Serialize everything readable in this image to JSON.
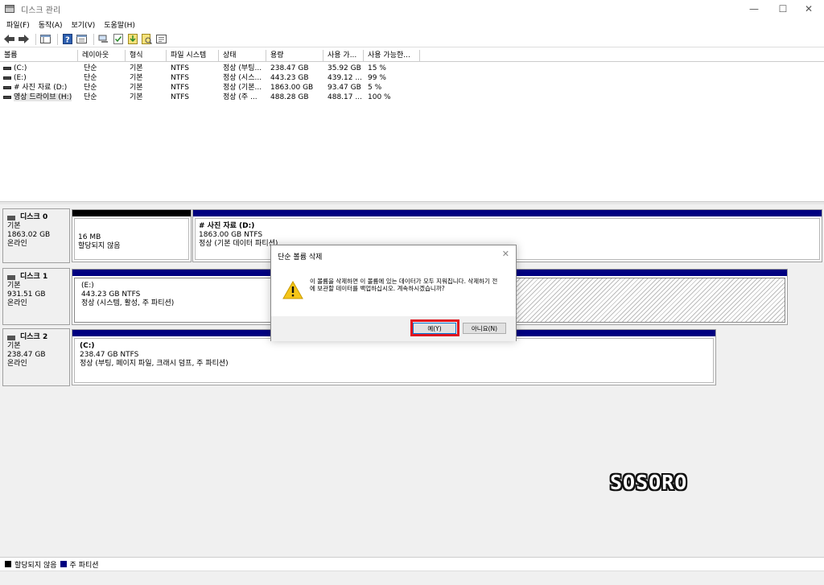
{
  "window": {
    "title": "디스크 관리",
    "minimize": "—",
    "maximize": "☐",
    "close": "✕"
  },
  "menu": [
    "파일(F)",
    "동작(A)",
    "보기(V)",
    "도움말(H)"
  ],
  "toolbar_icons": [
    "back-icon",
    "forward-icon",
    "console-tree-icon",
    "help-icon",
    "properties-icon",
    "connect-icon",
    "check-icon",
    "import-icon",
    "rescan-icon",
    "settings-icon"
  ],
  "volume_table": {
    "headers": [
      "볼륨",
      "레이아웃",
      "형식",
      "파일 시스템",
      "상태",
      "용량",
      "사용 가...",
      "사용 가능한..."
    ],
    "rows": [
      [
        "(C:)",
        "단순",
        "기본",
        "NTFS",
        "정상 (부팅...",
        "238.47 GB",
        "35.92 GB",
        "15 %"
      ],
      [
        "(E:)",
        "단순",
        "기본",
        "NTFS",
        "정상 (시스...",
        "443.23 GB",
        "439.12 ...",
        "99 %"
      ],
      [
        "# 사진 자료 (D:)",
        "단순",
        "기본",
        "NTFS",
        "정상 (기본...",
        "1863.00 GB",
        "93.47 GB",
        "5 %"
      ],
      [
        "영상 드라이브 (H:)",
        "단순",
        "기본",
        "NTFS",
        "정상 (주 ...",
        "488.28 GB",
        "488.17 ...",
        "100 %"
      ]
    ]
  },
  "disks": [
    {
      "name": "디스크 0",
      "type": "기본",
      "size": "1863.02 GB",
      "status": "온라인",
      "partitions": [
        {
          "name": "",
          "line1": "16 MB",
          "line2": "할당되지 않음"
        },
        {
          "name": "# 사진 자료  (D:)",
          "line1": "1863.00 GB NTFS",
          "line2": "정상 (기본 데이터 파티션)"
        }
      ]
    },
    {
      "name": "디스크 1",
      "type": "기본",
      "size": "931.51 GB",
      "status": "온라인",
      "partitions": [
        {
          "name": "(E:)",
          "line1": "443.23 GB NTFS",
          "line2": "정상 (시스템, 활성, 주 파티션)"
        }
      ]
    },
    {
      "name": "디스크 2",
      "type": "기본",
      "size": "238.47 GB",
      "status": "온라인",
      "partitions": [
        {
          "name": "(C:)",
          "line1": "238.47 GB NTFS",
          "line2": "정상 (부팅, 페이지 파일, 크래시 덤프, 주 파티션)"
        }
      ]
    }
  ],
  "legend": [
    {
      "label": "할당되지 않음",
      "color": "#000000"
    },
    {
      "label": "주 파티션",
      "color": "#000080"
    }
  ],
  "watermark": "SOSORO",
  "dialog": {
    "title": "단순 볼륨 삭제",
    "close": "✕",
    "message": "이 볼륨을 삭제하면 이 볼륨에 있는 데이터가 모두 지워집니다. 삭제하기 전에 보관할 데이터를 백업하십시오. 계속하시겠습니까?",
    "yes_label": "예(Y)",
    "no_label": "아니요(N)",
    "highlight_color": "#e0141e"
  }
}
